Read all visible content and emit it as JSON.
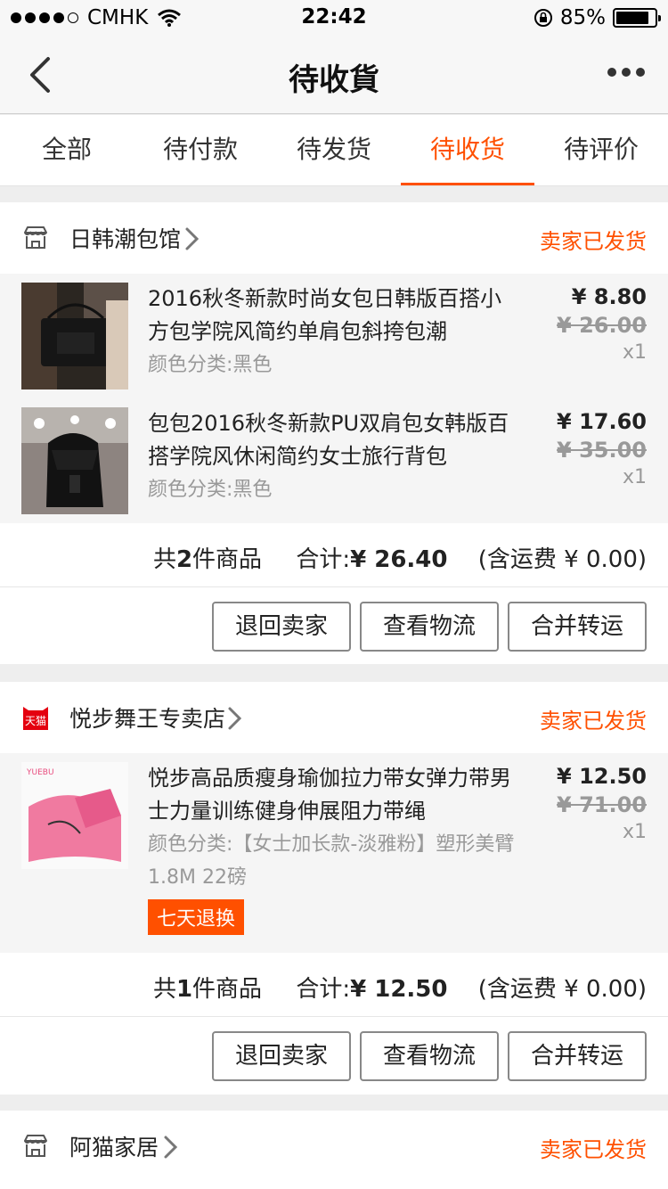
{
  "status_bar": {
    "carrier": "CMHK",
    "time": "22:42",
    "battery": "85%"
  },
  "nav": {
    "title": "待收貨"
  },
  "tabs": [
    {
      "label": "全部"
    },
    {
      "label": "待付款"
    },
    {
      "label": "待发货"
    },
    {
      "label": "待收货",
      "active": true
    },
    {
      "label": "待评价"
    }
  ],
  "orders": [
    {
      "shop": "日韩潮包馆",
      "status": "卖家已发货",
      "items": [
        {
          "name": "2016秋冬新款时尚女包日韩版百搭小方包学院风简约单肩包斜挎包潮",
          "spec": "颜色分类:黑色",
          "price": "¥ 8.80",
          "orig": "¥ 26.00",
          "qty": "x1"
        },
        {
          "name": "包包2016秋冬新款PU双肩包女韩版百搭学院风休闲简约女士旅行背包",
          "spec": "颜色分类:黑色",
          "price": "¥ 17.60",
          "orig": "¥ 35.00",
          "qty": "x1"
        }
      ],
      "summary_count_pre": "共",
      "summary_count": "2",
      "summary_count_post": "件商品",
      "summary_total_label": "合计:",
      "summary_total": "¥ 26.40",
      "summary_ship": "(含运费 ¥ 0.00)",
      "buttons": [
        "退回卖家",
        "查看物流",
        "合并转运"
      ]
    },
    {
      "shop": "悦步舞王专卖店",
      "shop_logo": "天猫",
      "status": "卖家已发货",
      "items": [
        {
          "name": "悦步高品质瘦身瑜伽拉力带女弹力带男士力量训练健身伸展阻力带绳",
          "spec": "颜色分类:【女士加长款-淡雅粉】塑形美臂1.8M 22磅",
          "price": "¥ 12.50",
          "orig": "¥ 71.00",
          "qty": "x1",
          "badge": "七天退换",
          "thumb_brand": "YUEBU"
        }
      ],
      "summary_count_pre": "共",
      "summary_count": "1",
      "summary_count_post": "件商品",
      "summary_total_label": "合计:",
      "summary_total": "¥ 12.50",
      "summary_ship": "(含运费 ¥ 0.00)",
      "buttons": [
        "退回卖家",
        "查看物流",
        "合并转运"
      ]
    },
    {
      "shop": "阿猫家居",
      "status": "卖家已发货"
    }
  ],
  "colors": {
    "accent": "#ff5000",
    "tmall_red": "#e4000f"
  },
  "icons": {
    "back": "chevron-left-icon",
    "more": "more-dots-icon",
    "store": "store-icon",
    "tmall": "tmall-icon",
    "chevron": "chevron-right-icon"
  }
}
